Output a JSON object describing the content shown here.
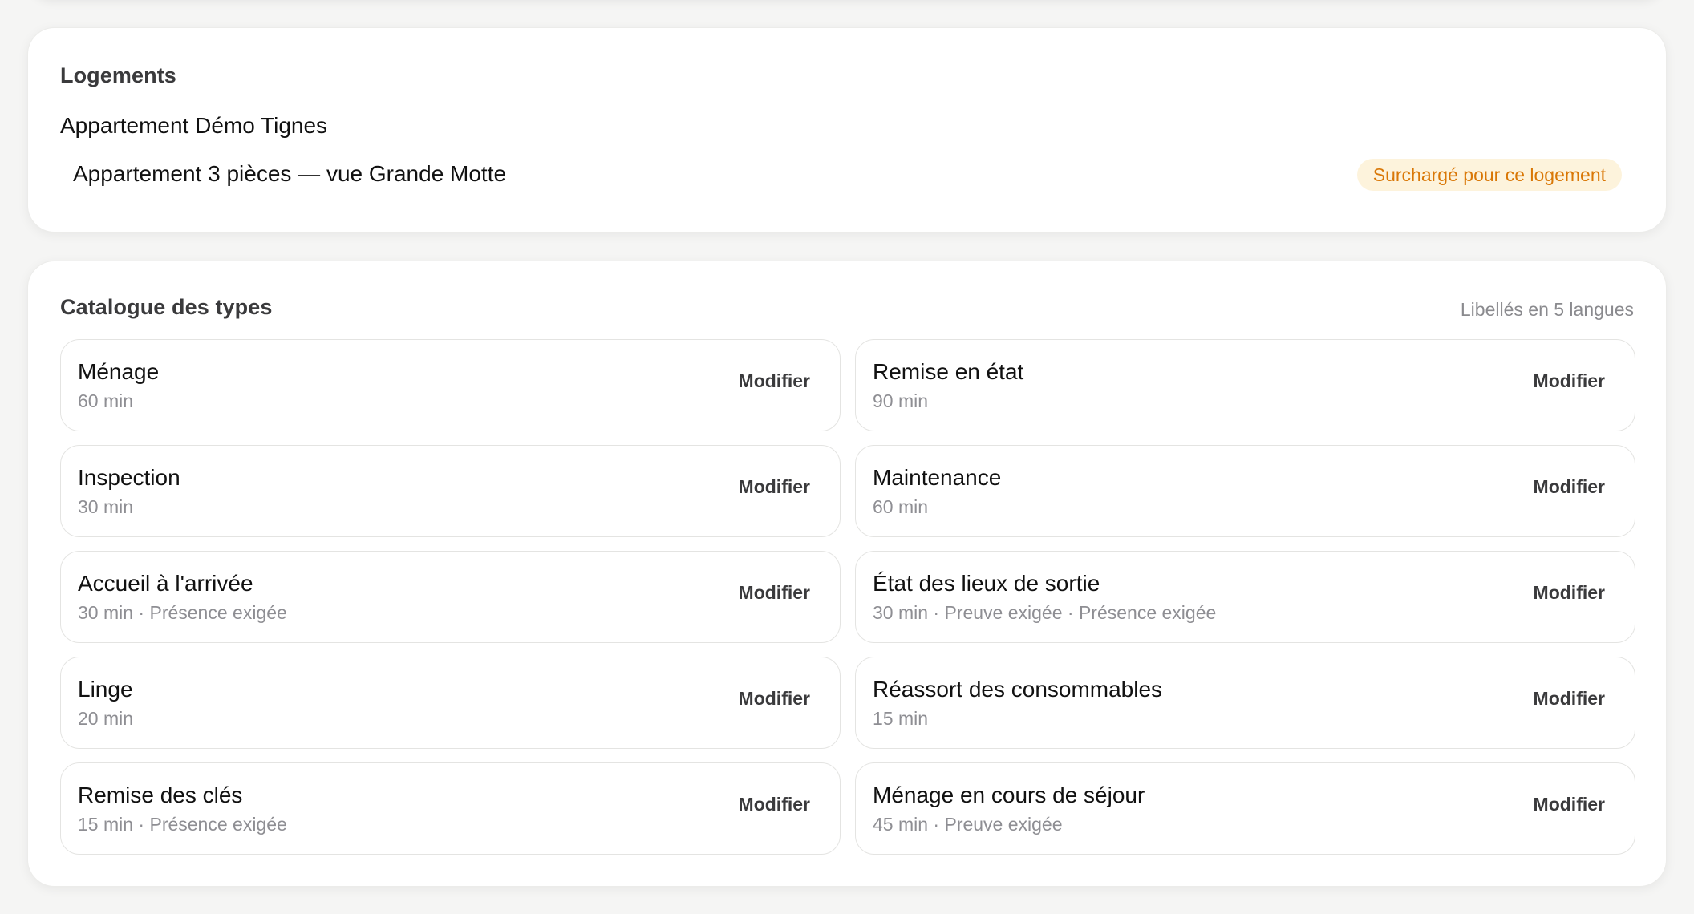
{
  "logements": {
    "title": "Logements",
    "property_name": "Appartement Démo Tignes",
    "unit": {
      "name": "Appartement 3 pièces — vue Grande Motte",
      "badge": "Surchargé pour ce logement"
    }
  },
  "catalogue": {
    "title": "Catalogue des types",
    "meta": "Libellés en 5 langues",
    "types": [
      {
        "name": "Ménage",
        "details": "60 min",
        "action": "Modifier"
      },
      {
        "name": "Remise en état",
        "details": "90 min",
        "action": "Modifier"
      },
      {
        "name": "Inspection",
        "details": "30 min",
        "action": "Modifier"
      },
      {
        "name": "Maintenance",
        "details": "60 min",
        "action": "Modifier"
      },
      {
        "name": "Accueil à l'arrivée",
        "details": "30 min · Présence exigée",
        "action": "Modifier"
      },
      {
        "name": "État des lieux de sortie",
        "details": "30 min · Preuve exigée · Présence exigée",
        "action": "Modifier"
      },
      {
        "name": "Linge",
        "details": "20 min",
        "action": "Modifier"
      },
      {
        "name": "Réassort des consommables",
        "details": "15 min",
        "action": "Modifier"
      },
      {
        "name": "Remise des clés",
        "details": "15 min · Présence exigée",
        "action": "Modifier"
      },
      {
        "name": "Ménage en cours de séjour",
        "details": "45 min · Preuve exigée",
        "action": "Modifier"
      }
    ]
  },
  "colors": {
    "badge_background": "#fdf3dc",
    "badge_text": "#d97706",
    "muted_text": "#8e8e93"
  }
}
